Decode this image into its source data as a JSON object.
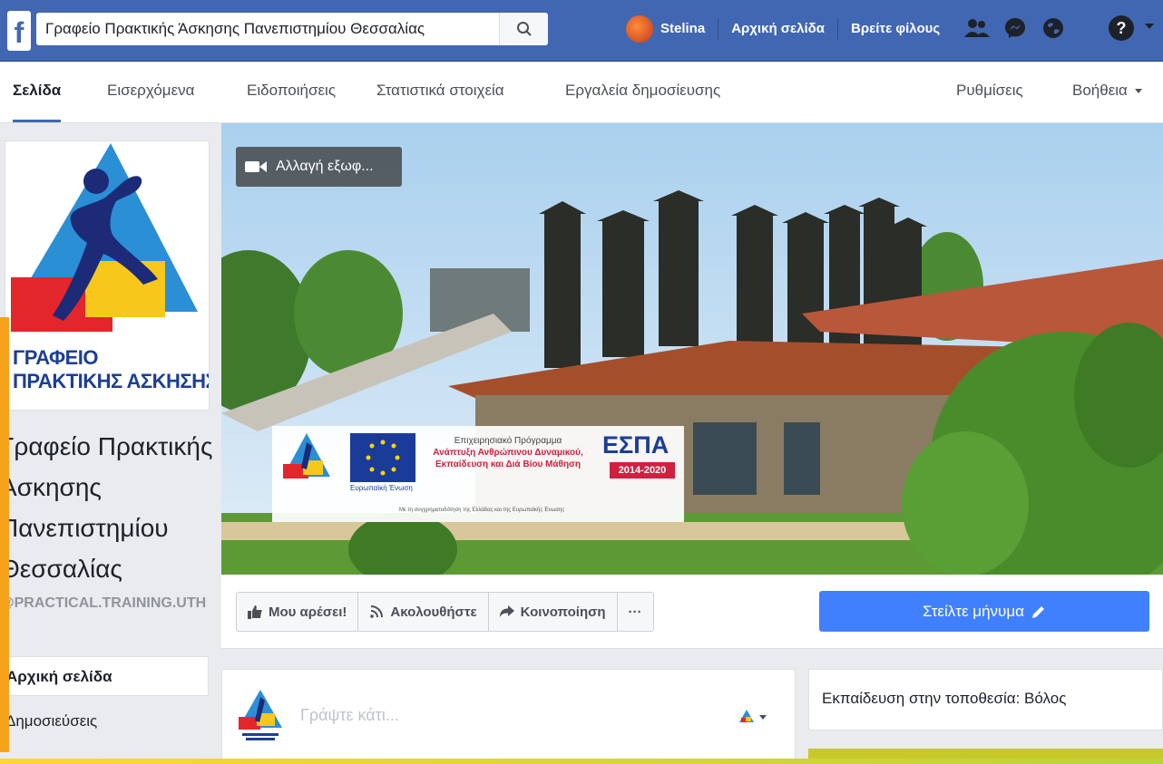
{
  "topbar": {
    "logo": "f",
    "search_value": "Γραφείο Πρακτικής Άσκησης Πανεπιστημίου Θεσσαλίας",
    "user_name": "Stelina",
    "home_link": "Αρχική σελίδα",
    "find_friends_link": "Βρείτε φίλους",
    "help": "?",
    "icons": [
      "search-icon",
      "friend-requests-icon",
      "messenger-icon",
      "notifications-globe-icon",
      "help-icon",
      "chevron-down-icon"
    ]
  },
  "page_tabs": {
    "page": "Σελίδα",
    "inbox": "Εισερχόμενα",
    "notifications": "Ειδοποιήσεις",
    "insights": "Στατιστικά στοιχεία",
    "publishing_tools": "Εργαλεία δημοσίευσης",
    "settings": "Ρυθμίσεις",
    "help": "Βοήθεια"
  },
  "profile": {
    "logo_line1": "ΓΡΑΦΕΙΟ",
    "logo_line2": "ΠΡΑΚΤΙΚΗΣ ΑΣΚΗΣΗΣ",
    "name": "Γραφείο Πρακτικής Άσκησης Πανεπιστημίου Θεσσαλίας",
    "handle": "@PRACTICAL.TRAINING.UTH"
  },
  "left_nav": {
    "home": "Αρχική σελίδα",
    "posts": "Δημοσιεύσεις"
  },
  "cover": {
    "change_cover": "Αλλαγή εξωφ...",
    "banner": {
      "program_title": "Επιχειρησιακό Πρόγραμμα",
      "program_line1": "Ανάπτυξη Ανθρώπινου Δυναμικού,",
      "program_line2": "Εκπαίδευση και Διά Βίου Μάθηση",
      "espa_label": "ΕΣΠΑ",
      "espa_years": "2014-2020",
      "eu_label": "Ευρωπαϊκή Ένωση",
      "footer": "Με τη συγχρηματοδότηση της Ελλάδας και της Ευρωπαϊκής Ένωσης"
    }
  },
  "actions": {
    "like": "Μου αρέσει!",
    "follow": "Ακολουθήστε",
    "share": "Κοινοποίηση",
    "more": "···",
    "send_message": "Στείλτε μήνυμα"
  },
  "composer": {
    "placeholder": "Γράψτε κάτι..."
  },
  "info_card": {
    "text": "Εκπαίδευση στην τοποθεσία: Βόλος"
  },
  "colors": {
    "facebook_blue": "#4267b2",
    "send_button": "#4080ff",
    "accent_orange": "#f7a21b"
  }
}
